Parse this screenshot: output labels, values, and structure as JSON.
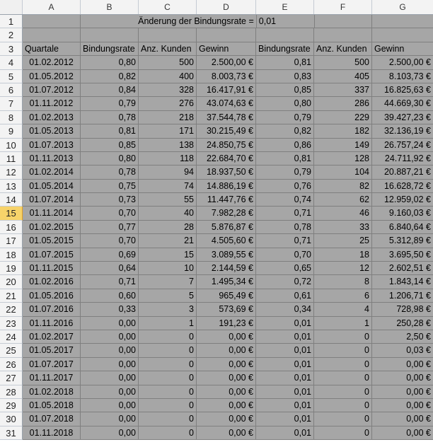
{
  "columns": [
    "A",
    "B",
    "C",
    "D",
    "E",
    "F",
    "G"
  ],
  "header_row1": {
    "label": "Änderung der Bindungsrate =",
    "value": "0,01"
  },
  "header_row3": [
    "Quartale",
    "Bindungsrate",
    "Anz. Kunden",
    "Gewinn",
    "Bindungsrate",
    "Anz. Kunden",
    "Gewinn"
  ],
  "active_row": 15,
  "rows": [
    [
      "4",
      "01.02.2012",
      "0,80",
      "500",
      "2.500,00 €",
      "0,81",
      "500",
      "2.500,00 €"
    ],
    [
      "5",
      "01.05.2012",
      "0,82",
      "400",
      "8.003,73 €",
      "0,83",
      "405",
      "8.103,73 €"
    ],
    [
      "6",
      "01.07.2012",
      "0,84",
      "328",
      "16.417,91 €",
      "0,85",
      "337",
      "16.825,63 €"
    ],
    [
      "7",
      "01.11.2012",
      "0,79",
      "276",
      "43.074,63 €",
      "0,80",
      "286",
      "44.669,30 €"
    ],
    [
      "8",
      "01.02.2013",
      "0,78",
      "218",
      "37.544,78 €",
      "0,79",
      "229",
      "39.427,23 €"
    ],
    [
      "9",
      "01.05.2013",
      "0,81",
      "171",
      "30.215,49 €",
      "0,82",
      "182",
      "32.136,19 €"
    ],
    [
      "10",
      "01.07.2013",
      "0,85",
      "138",
      "24.850,75 €",
      "0,86",
      "149",
      "26.757,24 €"
    ],
    [
      "11",
      "01.11.2013",
      "0,80",
      "118",
      "22.684,70 €",
      "0,81",
      "128",
      "24.711,92 €"
    ],
    [
      "12",
      "01.02.2014",
      "0,78",
      "94",
      "18.937,50 €",
      "0,79",
      "104",
      "20.887,21 €"
    ],
    [
      "13",
      "01.05.2014",
      "0,75",
      "74",
      "14.886,19 €",
      "0,76",
      "82",
      "16.628,72 €"
    ],
    [
      "14",
      "01.07.2014",
      "0,73",
      "55",
      "11.447,76 €",
      "0,74",
      "62",
      "12.959,02 €"
    ],
    [
      "15",
      "01.11.2014",
      "0,70",
      "40",
      "7.982,28 €",
      "0,71",
      "46",
      "9.160,03 €"
    ],
    [
      "16",
      "01.02.2015",
      "0,77",
      "28",
      "5.876,87 €",
      "0,78",
      "33",
      "6.840,64 €"
    ],
    [
      "17",
      "01.05.2015",
      "0,70",
      "21",
      "4.505,60 €",
      "0,71",
      "25",
      "5.312,89 €"
    ],
    [
      "18",
      "01.07.2015",
      "0,69",
      "15",
      "3.089,55 €",
      "0,70",
      "18",
      "3.695,50 €"
    ],
    [
      "19",
      "01.11.2015",
      "0,64",
      "10",
      "2.144,59 €",
      "0,65",
      "12",
      "2.602,51 €"
    ],
    [
      "20",
      "01.02.2016",
      "0,71",
      "7",
      "1.495,34 €",
      "0,72",
      "8",
      "1.843,14 €"
    ],
    [
      "21",
      "01.05.2016",
      "0,60",
      "5",
      "965,49 €",
      "0,61",
      "6",
      "1.206,71 €"
    ],
    [
      "22",
      "01.07.2016",
      "0,33",
      "3",
      "573,69 €",
      "0,34",
      "4",
      "728,98 €"
    ],
    [
      "23",
      "01.11.2016",
      "0,00",
      "1",
      "191,23 €",
      "0,01",
      "1",
      "250,28 €"
    ],
    [
      "24",
      "01.02.2017",
      "0,00",
      "0",
      "0,00 €",
      "0,01",
      "0",
      "2,50 €"
    ],
    [
      "25",
      "01.05.2017",
      "0,00",
      "0",
      "0,00 €",
      "0,01",
      "0",
      "0,03 €"
    ],
    [
      "26",
      "01.07.2017",
      "0,00",
      "0",
      "0,00 €",
      "0,01",
      "0",
      "0,00 €"
    ],
    [
      "27",
      "01.11.2017",
      "0,00",
      "0",
      "0,00 €",
      "0,01",
      "0",
      "0,00 €"
    ],
    [
      "28",
      "01.02.2018",
      "0,00",
      "0",
      "0,00 €",
      "0,01",
      "0",
      "0,00 €"
    ],
    [
      "29",
      "01.05.2018",
      "0,00",
      "0",
      "0,00 €",
      "0,01",
      "0",
      "0,00 €"
    ],
    [
      "30",
      "01.07.2018",
      "0,00",
      "0",
      "0,00 €",
      "0,01",
      "0",
      "0,00 €"
    ],
    [
      "31",
      "01.11.2018",
      "0,00",
      "0",
      "0,00 €",
      "0,01",
      "0",
      "0,00 €"
    ]
  ]
}
